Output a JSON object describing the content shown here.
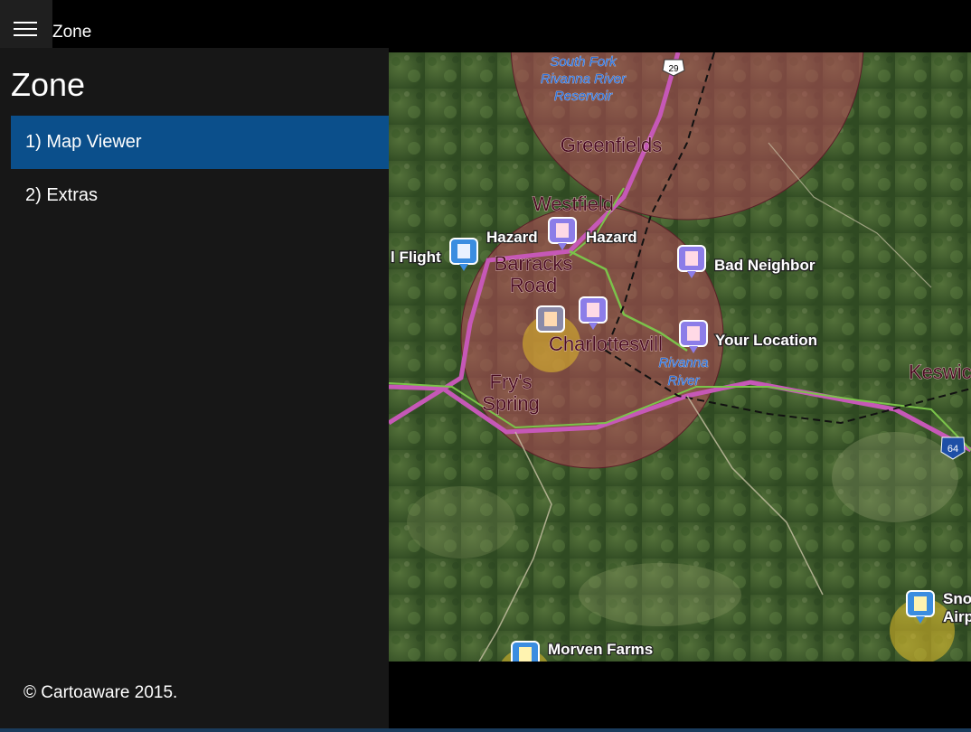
{
  "app": {
    "title": "Zone"
  },
  "nav": {
    "header": "Zone",
    "items": [
      {
        "label": "1) Map Viewer",
        "selected": true
      },
      {
        "label": "2) Extras",
        "selected": false
      }
    ],
    "footer": "© Cartoaware 2015."
  },
  "colors": {
    "accent": "#0b4f8b",
    "nav_bg": "#171717",
    "zone_red": "#b8485a",
    "zone_yellow": "#e4bd2a"
  },
  "map": {
    "place_labels": {
      "greenfields": "Greenfields",
      "westfield": "Westfield",
      "barracks_road_1": "Barracks",
      "barracks_road_2": "Road",
      "charlottesville": "Charlottesvill",
      "frys_spring_1": "Fry's",
      "frys_spring_2": "Spring",
      "keswick": "Keswic"
    },
    "water_labels": {
      "reservoir_1": "South Fork",
      "reservoir_2": "Rivanna River",
      "reservoir_3": "Reservoir",
      "river_1": "Rivanna",
      "river_2": "River"
    },
    "markers": {
      "hazard_1": "Hazard",
      "hazard_2": "Hazard",
      "flight": "l Flight",
      "bad_neighbor": "Bad Neighbor",
      "your_location": "Your Location",
      "morven_farms": "Morven Farms",
      "snow_airport_1": "Sno",
      "snow_airport_2": "Airp"
    },
    "route_shields": {
      "us29": "29",
      "i64": "64"
    }
  }
}
